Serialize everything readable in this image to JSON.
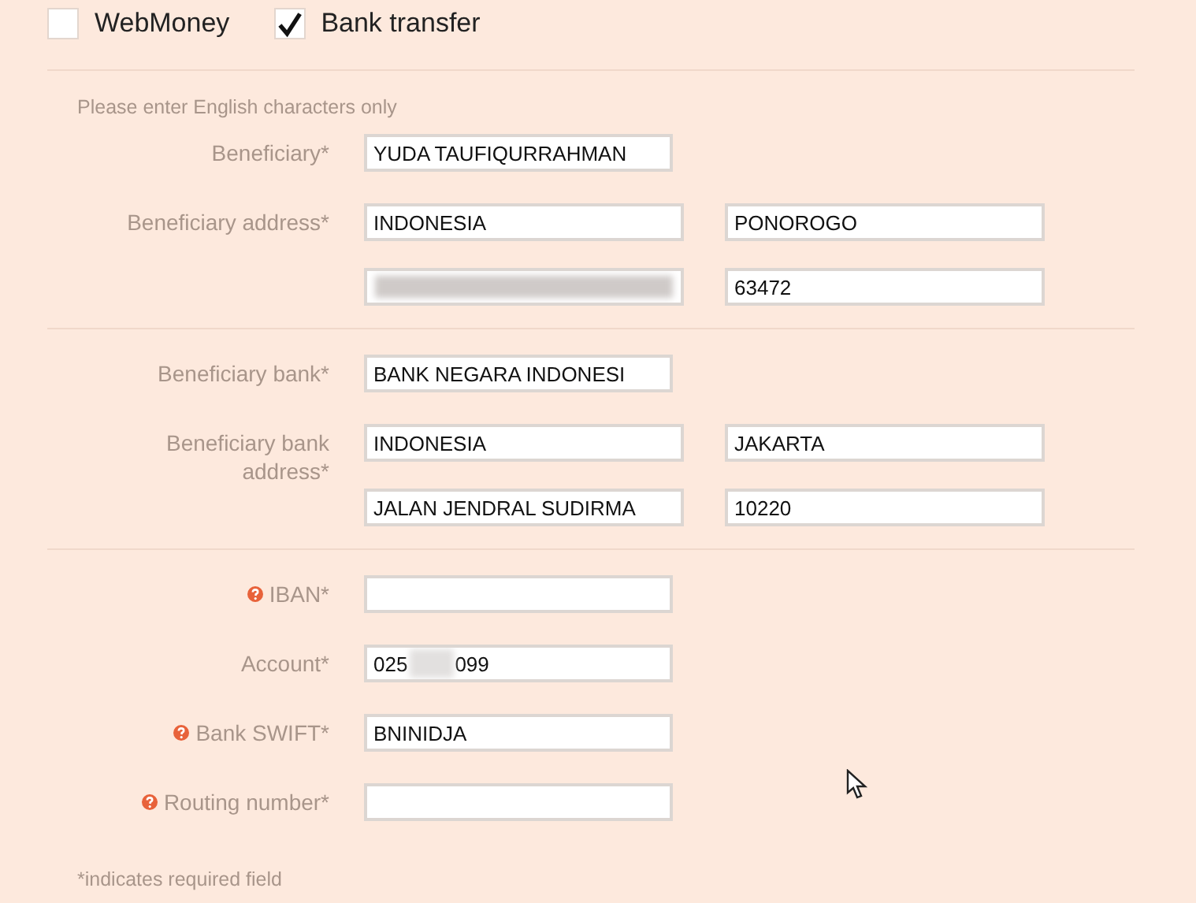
{
  "payment_methods": [
    {
      "label": "WebMoney",
      "checked": false
    },
    {
      "label": "Bank transfer",
      "checked": true
    }
  ],
  "hint": "Please enter English characters only",
  "sections": [
    {
      "rows": [
        {
          "label": "Beneficiary*",
          "help": false,
          "lines": [
            [
              {
                "kind": "text",
                "value": "YUDA TAUFIQURRAHMAN"
              }
            ]
          ]
        },
        {
          "label": "Beneficiary address*",
          "help": false,
          "lines": [
            [
              {
                "kind": "text",
                "value": "INDONESIA"
              },
              {
                "kind": "text",
                "value": "PONOROGO"
              }
            ],
            [
              {
                "kind": "blurred"
              },
              {
                "kind": "text",
                "value": "63472"
              }
            ]
          ]
        }
      ]
    },
    {
      "rows": [
        {
          "label": "Beneficiary bank*",
          "help": false,
          "lines": [
            [
              {
                "kind": "text",
                "value": "BANK NEGARA INDONESI"
              }
            ]
          ]
        },
        {
          "label": "Beneficiary bank address*",
          "help": false,
          "lines": [
            [
              {
                "kind": "text",
                "value": "INDONESIA"
              },
              {
                "kind": "text",
                "value": "JAKARTA"
              }
            ],
            [
              {
                "kind": "text",
                "value": "JALAN JENDRAL SUDIRMA"
              },
              {
                "kind": "text",
                "value": "10220"
              }
            ]
          ]
        }
      ]
    },
    {
      "rows": [
        {
          "label": "IBAN*",
          "help": true,
          "lines": [
            [
              {
                "kind": "empty"
              }
            ]
          ]
        },
        {
          "label": "Account*",
          "help": false,
          "lines": [
            [
              {
                "kind": "partly_blurred",
                "value_parts": [
                  "025",
                  "099"
                ]
              }
            ]
          ]
        },
        {
          "label": "Bank SWIFT*",
          "help": true,
          "lines": [
            [
              {
                "kind": "text",
                "value": "BNINIDJA"
              }
            ]
          ]
        },
        {
          "label": "Routing number*",
          "help": true,
          "lines": [
            [
              {
                "kind": "empty"
              }
            ]
          ]
        }
      ]
    }
  ],
  "footnote": "*indicates required field"
}
